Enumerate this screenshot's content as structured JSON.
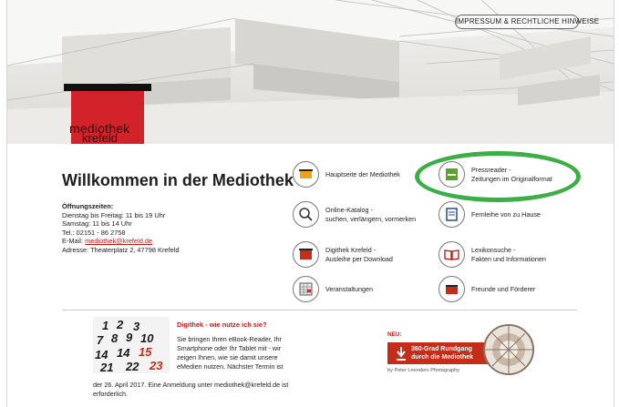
{
  "header": {
    "impressum_label": "IMPRESSUM & RECHTLICHE HINWEISE",
    "logo_line1": "mediothek",
    "logo_line2": "krefeld"
  },
  "welcome": {
    "title": "Willkommen in der Mediothek",
    "hours_heading": "Öffnungszeiten:",
    "hours_line1": "Dienstag bis Freitag: 11 bis 19 Uhr",
    "hours_line2": "Samstag: 11 bis 14 Uhr",
    "phone": "Tel.: 02151 - 86 2758",
    "email_label": "E-Mail: ",
    "email": "mediothek@krefeld.de",
    "address": "Adresse: Theaterplatz 2, 47798 Krefeld"
  },
  "tiles": [
    {
      "line1": "Hauptseite der Mediothek",
      "line2": "",
      "icon": "mediothek-logo-icon"
    },
    {
      "line1": "Pressreader -",
      "line2": "Zeitungen im Originalformat",
      "icon": "pressreader-icon"
    },
    {
      "line1": "Online-Katalog -",
      "line2": "suchen, verlängern, vormerken",
      "icon": "magnifier-icon"
    },
    {
      "line1": "Fernleihe von zu Hause",
      "line2": "",
      "icon": "book-pages-icon"
    },
    {
      "line1": "Digithek Krefeld -",
      "line2": "Ausleihe per Download",
      "icon": "digithek-icon"
    },
    {
      "line1": "Lexikonsuche -",
      "line2": "Fakten und Informationen",
      "icon": "open-book-icon"
    },
    {
      "line1": "Veranstaltungen",
      "line2": "",
      "icon": "calendar-grid-icon"
    },
    {
      "line1": "Freunde und Förderer",
      "line2": "",
      "icon": "friends-logo-icon"
    }
  ],
  "news": {
    "title": "Digithek - wie nutze ich sie?",
    "body": "Sie bringen Ihren eBook-Reader, Ihr Smartphone oder Ihr Tablet mit - wir zeigen Ihnen, wie sie damit unsere eMedien nutzen. Nächster Termin ist",
    "tail": "der 26. April 2017. Eine Anmeldung unter mediothek@krefeld.de ist erforderlich."
  },
  "tour": {
    "neu_label": "NEU:",
    "banner_line1": "360-Grad Rundgang",
    "banner_line2": "durch die Mediothek",
    "credit": "by Peter Leenders Photography"
  },
  "colors": {
    "accent_red": "#d2232a",
    "highlight_green": "#3cae47"
  }
}
